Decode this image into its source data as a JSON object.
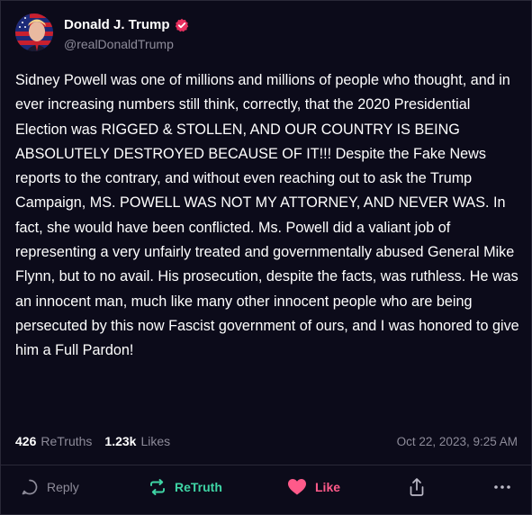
{
  "author": {
    "display_name": "Donald J. Trump",
    "handle": "@realDonaldTrump",
    "verified_icon": "verified-badge-icon",
    "verified_color": "#e8305f"
  },
  "post": {
    "text": "Sidney Powell was one of millions and millions of people who thought, and in ever increasing numbers still think, correctly, that the 2020 Presidential Election was RIGGED & STOLLEN, AND OUR COUNTRY IS BEING ABSOLUTELY DESTROYED BECAUSE OF IT!!! Despite the Fake News reports to the contrary, and without even reaching out to ask the Trump Campaign, MS. POWELL WAS NOT MY ATTORNEY, AND NEVER WAS. In fact, she would have been conflicted. Ms. Powell did a valiant job of representing a very unfairly treated and governmentally abused General Mike Flynn, but to no avail. His prosecution, despite the facts, was ruthless. He was an innocent man, much like many other innocent people who are being persecuted by this now Fascist government of ours, and I was honored to give him a Full Pardon!"
  },
  "stats": {
    "retruths_count": "426",
    "retruths_label": "ReTruths",
    "likes_count": "1.23k",
    "likes_label": "Likes",
    "timestamp": "Oct 22, 2023, 9:25 AM"
  },
  "actions": {
    "reply_label": "Reply",
    "reply_icon": "speech-bubble-icon",
    "retruth_label": "ReTruth",
    "retruth_icon": "retruth-arrows-icon",
    "retruth_color": "#3fd5a5",
    "like_label": "Like",
    "like_icon": "heart-icon",
    "like_color": "#ff5a8a",
    "share_icon": "share-icon",
    "more_icon": "more-dots-icon"
  },
  "colors": {
    "background": "#0c0b1a",
    "muted_text": "#8d8b99",
    "divider": "#2a2838"
  }
}
